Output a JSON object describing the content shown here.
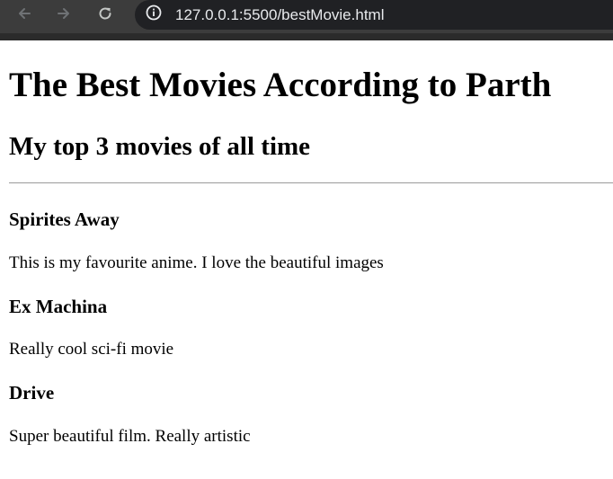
{
  "browser": {
    "url": "127.0.0.1:5500/bestMovie.html",
    "icons": {
      "back": "arrow-left-icon",
      "forward": "arrow-right-icon",
      "reload": "reload-icon",
      "site_info": "info-circle-icon"
    },
    "colors": {
      "toolbar": "#3c3c3c",
      "omnibox": "#202124",
      "url_text": "#e8eaed",
      "icon": "#c4c7c5"
    }
  },
  "page": {
    "title": "The Best Movies According to Parth",
    "subtitle": "My top 3 movies of all time",
    "movies": [
      {
        "title": "Spirites Away",
        "description": "This is my favourite anime. I love the beautiful images"
      },
      {
        "title": "Ex Machina",
        "description": "Really cool sci-fi movie"
      },
      {
        "title": "Drive",
        "description": "Super beautiful film. Really artistic"
      }
    ]
  }
}
